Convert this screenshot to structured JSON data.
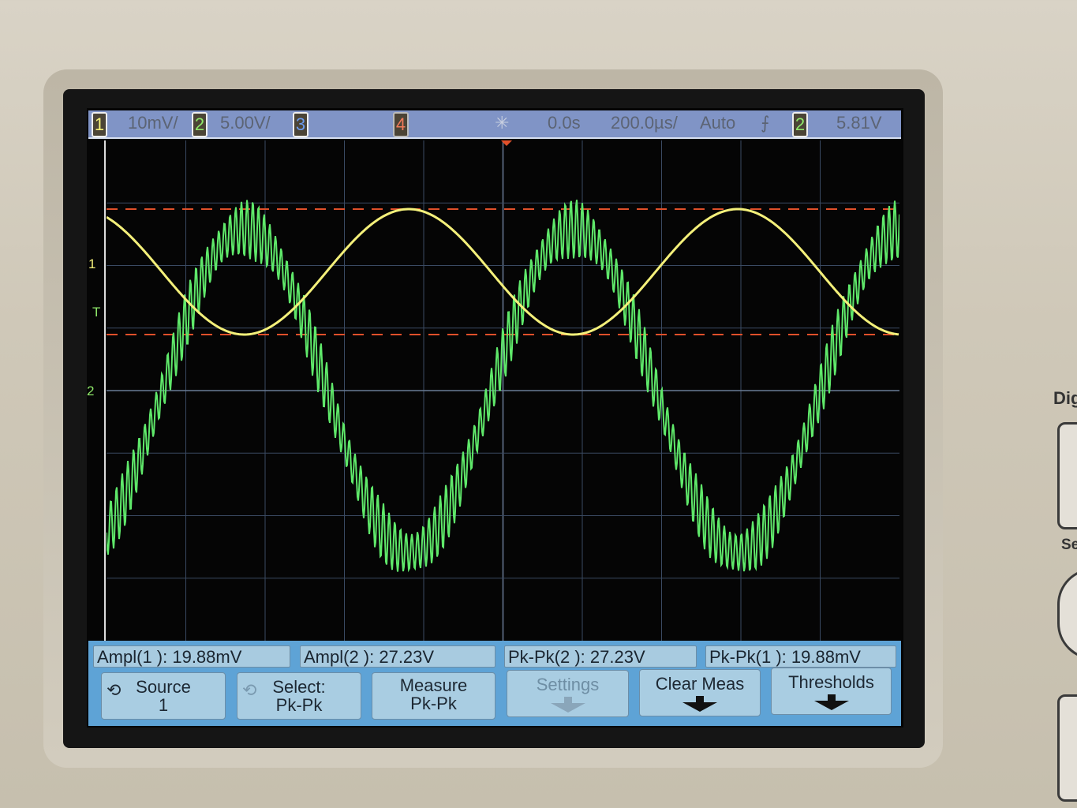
{
  "status_bar": {
    "ch1_label": "1",
    "ch1_scale": "10mV/",
    "ch2_label": "2",
    "ch2_scale": "5.00V/",
    "ch3_label": "3",
    "ch4_label": "4",
    "trigger_icon": "trigger-sun-icon",
    "time_delay": "0.0s",
    "time_scale": "200.0µs/",
    "trigger_mode": "Auto",
    "trigger_slope": "⨍",
    "trigger_source": "2",
    "trigger_level": "5.81V"
  },
  "markers": {
    "ch1": "1",
    "trigger": "T",
    "ch2": "2"
  },
  "measurements": [
    "Ampl(1 ): 19.88mV",
    "Ampl(2 ): 27.23V",
    "Pk-Pk(2 ): 27.23V",
    "Pk-Pk(1 ): 19.88mV"
  ],
  "softkeys": [
    {
      "line1": "Source",
      "line2": "1"
    },
    {
      "line1": "Select:",
      "line2": "Pk-Pk"
    },
    {
      "line1": "Measure",
      "line2": "Pk-Pk"
    },
    {
      "line1": "Settings"
    },
    {
      "line1": "Clear Meas"
    },
    {
      "line1": "Thresholds"
    }
  ],
  "side_labels": {
    "top": "Dig",
    "bottom": "Se"
  },
  "colors": {
    "ch1": "#f4f07a",
    "ch2": "#5fe86a",
    "ch3": "#6c9cf0",
    "ch4": "#f07a5a",
    "cursor": "#e0502a",
    "status_bar": "#8094c6"
  }
}
